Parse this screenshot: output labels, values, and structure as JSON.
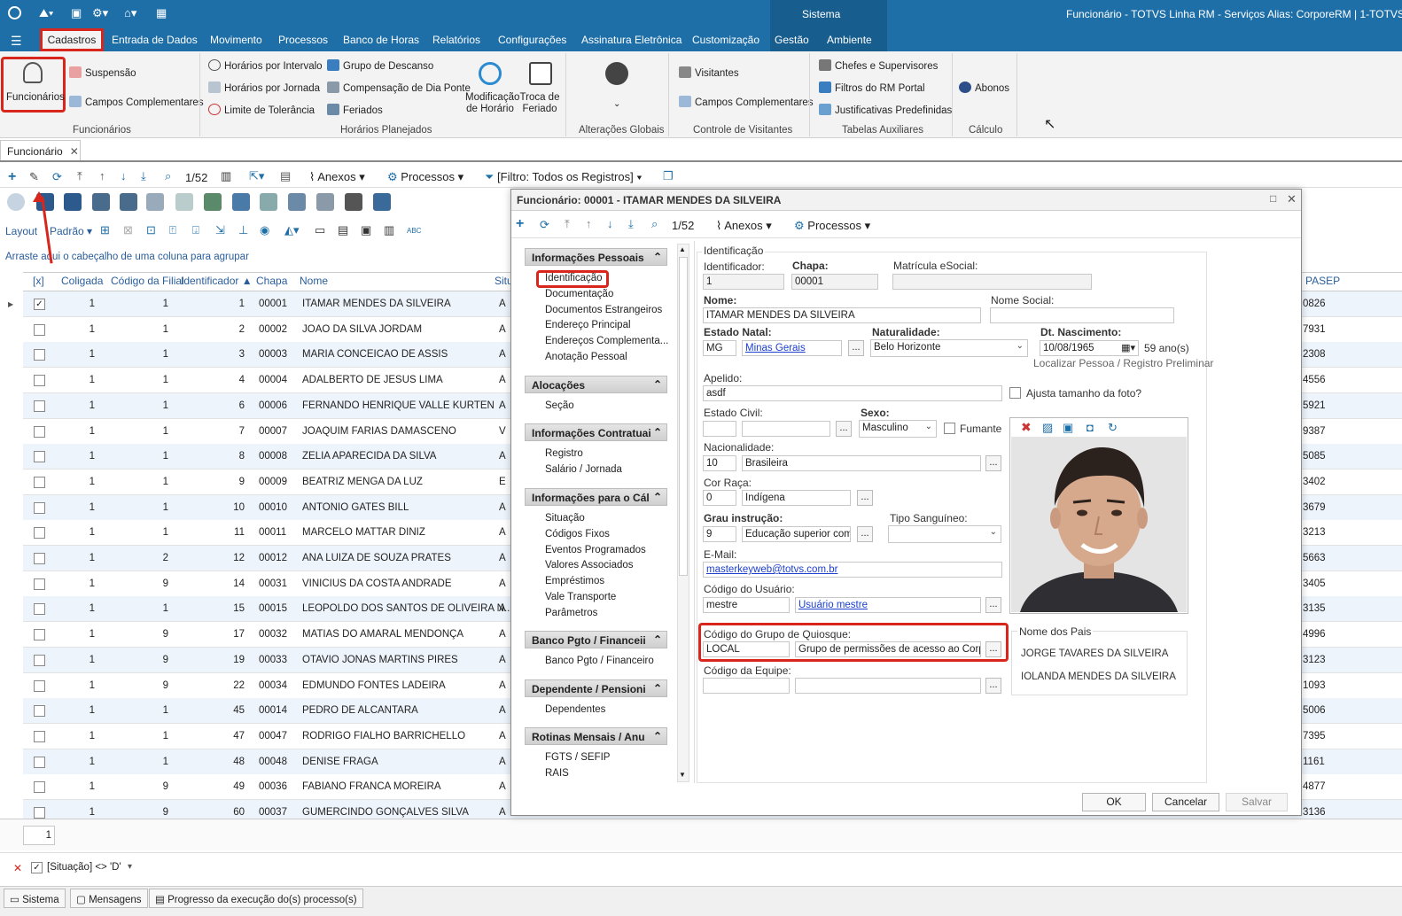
{
  "titlebar": {
    "right_text": "Funcionário - TOTVS Linha RM - Serviços  Alias: CorporeRM | 1-TOTVS SA",
    "sistema_label": "Sistema"
  },
  "menu": [
    "Cadastros",
    "Entrada de Dados",
    "Movimento",
    "Processos",
    "Banco de Horas",
    "Relatórios",
    "Configurações",
    "Assinatura Eletrônica",
    "Customização",
    "Gestão",
    "Ambiente"
  ],
  "ribbon": {
    "funcionarios": {
      "big": "Funcionários",
      "suspensao": "Suspensão",
      "campos": "Campos Complementares",
      "group": "Funcionários"
    },
    "horarios": {
      "intervalo": "Horários por Intervalo",
      "jornada": "Horários por Jornada",
      "limite": "Limite de Tolerância",
      "grupo": "Grupo de Descanso",
      "compensacao": "Compensação de Dia Ponte",
      "feriados": "Feriados",
      "modificacao": "Modificação de Horário",
      "troca": "Troca de Feriado",
      "group": "Horários Planejados"
    },
    "alteracoes": {
      "group": "Alterações Globais"
    },
    "visitantes": {
      "visitantes": "Visitantes",
      "campos": "Campos Complementares",
      "group": "Controle de Visitantes"
    },
    "tabelas": {
      "chefes": "Chefes e Supervisores",
      "filtros": "Filtros do RM Portal",
      "justificativas": "Justificativas Predefinidas",
      "group": "Tabelas Auxiliares"
    },
    "calculo": {
      "abonos": "Abonos",
      "group": "Cálculo"
    }
  },
  "doc_tab": "Funcionário",
  "toolbar": {
    "counter": "1/52",
    "anexos": "Anexos",
    "processos": "Processos",
    "filtro": "[Filtro: Todos os Registros]"
  },
  "layout_bar": {
    "layout": "Layout",
    "padrao": "Padrão"
  },
  "group_hint": "Arraste aqui o cabeçalho de uma coluna para agrupar",
  "grid": {
    "headers": [
      "[x]",
      "Coligada",
      "Código da Filial",
      "Identificador",
      "Chapa",
      "Nome",
      "Situ",
      "PASEP"
    ],
    "rows": [
      [
        "1",
        "1",
        "1",
        "00001",
        "ITAMAR MENDES DA SILVEIRA",
        "A",
        "0826"
      ],
      [
        "1",
        "1",
        "2",
        "00002",
        "JOAO DA SILVA JORDAM",
        "A",
        "7931"
      ],
      [
        "1",
        "1",
        "3",
        "00003",
        "MARIA CONCEICAO DE ASSIS",
        "A",
        "2308"
      ],
      [
        "1",
        "1",
        "4",
        "00004",
        "ADALBERTO DE JESUS LIMA",
        "A",
        "4556"
      ],
      [
        "1",
        "1",
        "6",
        "00006",
        "FERNANDO HENRIQUE VALLE KURTEN",
        "A",
        "5921"
      ],
      [
        "1",
        "1",
        "7",
        "00007",
        "JOAQUIM FARIAS DAMASCENO",
        "V",
        "9387"
      ],
      [
        "1",
        "1",
        "8",
        "00008",
        "ZELIA APARECIDA DA SILVA",
        "A",
        "5085"
      ],
      [
        "1",
        "1",
        "9",
        "00009",
        "BEATRIZ MENGA DA LUZ",
        "E",
        "3402"
      ],
      [
        "1",
        "1",
        "10",
        "00010",
        "ANTONIO GATES BILL",
        "A",
        "3679"
      ],
      [
        "1",
        "1",
        "11",
        "00011",
        "MARCELO MATTAR DINIZ",
        "A",
        "3213"
      ],
      [
        "1",
        "2",
        "12",
        "00012",
        "ANA LUIZA  DE SOUZA PRATES",
        "A",
        "5663"
      ],
      [
        "1",
        "9",
        "14",
        "00031",
        "VINICIUS DA COSTA ANDRADE",
        "A",
        "3405"
      ],
      [
        "1",
        "1",
        "15",
        "00015",
        "LEOPOLDO DOS SANTOS DE OLIVEIRA N...",
        "A",
        "3135"
      ],
      [
        "1",
        "9",
        "17",
        "00032",
        "MATIAS DO AMARAL MENDONÇA",
        "A",
        "4996"
      ],
      [
        "1",
        "9",
        "19",
        "00033",
        "OTAVIO JONAS MARTINS PIRES",
        "A",
        "3123"
      ],
      [
        "1",
        "9",
        "22",
        "00034",
        "EDMUNDO FONTES LADEIRA",
        "A",
        "1093"
      ],
      [
        "1",
        "1",
        "45",
        "00014",
        "PEDRO DE ALCANTARA",
        "A",
        "5006"
      ],
      [
        "1",
        "1",
        "47",
        "00047",
        "RODRIGO FIALHO BARRICHELLO",
        "A",
        "7395"
      ],
      [
        "1",
        "1",
        "48",
        "00048",
        "DENISE FRAGA",
        "A",
        "1161"
      ],
      [
        "1",
        "9",
        "49",
        "00036",
        "FABIANO FRANCA MOREIRA",
        "A",
        "4877"
      ],
      [
        "1",
        "9",
        "60",
        "00037",
        "GUMERCINDO GONÇALVES SILVA",
        "A",
        "3136"
      ]
    ],
    "footer_count": "1"
  },
  "filter_bar": {
    "text": "[Situação] <> 'D'"
  },
  "statusbar": {
    "sistema": "Sistema",
    "mensagens": "Mensagens",
    "progresso": "Progresso da execução do(s) processo(s)"
  },
  "modal": {
    "title": "Funcionário: 00001 - ITAMAR MENDES DA SILVEIRA",
    "counter": "1/52",
    "anexos": "Anexos",
    "processos": "Processos",
    "nav": [
      {
        "title": "Informações Pessoais",
        "items": [
          "Identificação",
          "Documentação",
          "Documentos Estrangeiros",
          "Endereço Principal",
          "Endereços Complementa...",
          "Anotação Pessoal"
        ]
      },
      {
        "title": "Alocações",
        "items": [
          "Seção"
        ]
      },
      {
        "title": "Informações Contratuai",
        "items": [
          "Registro",
          "Salário / Jornada"
        ]
      },
      {
        "title": "Informações para o Cál",
        "items": [
          "Situação",
          "Códigos Fixos",
          "Eventos Programados",
          "Valores Associados",
          "Empréstimos",
          "Vale Transporte",
          "Parâmetros"
        ]
      },
      {
        "title": "Banco Pgto / Financeii",
        "items": [
          "Banco Pgto / Financeiro"
        ]
      },
      {
        "title": "Dependente / Pensioni",
        "items": [
          "Dependentes"
        ]
      },
      {
        "title": "Rotinas Mensais / Anu",
        "items": [
          "FGTS / SEFIP",
          "RAIS"
        ]
      }
    ],
    "form": {
      "section": "Identificação",
      "identificador_label": "Identificador:",
      "identificador": "1",
      "chapa_label": "Chapa:",
      "chapa": "00001",
      "matricula_label": "Matrícula eSocial:",
      "matricula": "",
      "nome_label": "Nome:",
      "nome": "ITAMAR MENDES DA SILVEIRA",
      "nome_social_label": "Nome Social:",
      "nome_social": "",
      "estado_label": "Estado Natal:",
      "estado": "MG",
      "estado_nome": "Minas Gerais",
      "naturalidade_label": "Naturalidade:",
      "naturalidade": "Belo Horizonte",
      "dt_nasc_label": "Dt. Nascimento:",
      "dt_nasc": "10/08/1965",
      "idade": "59 ano(s)",
      "localizar": "Localizar Pessoa / Registro Preliminar",
      "apelido_label": "Apelido:",
      "apelido": "asdf",
      "ajusta": "Ajusta tamanho da foto?",
      "estado_civil_label": "Estado Civil:",
      "sexo_label": "Sexo:",
      "sexo": "Masculino",
      "fumante": "Fumante",
      "nacionalidade_label": "Nacionalidade:",
      "nac_cod": "10",
      "nac": "Brasileira",
      "cor_label": "Cor Raça:",
      "cor_cod": "0",
      "cor": "Indígena",
      "grau_label": "Grau instrução:",
      "grau_cod": "9",
      "grau": "Educação superior compl",
      "sangue_label": "Tipo Sanguíneo:",
      "email_label": "E-Mail:",
      "email": "masterkeyweb@totvs.com.br",
      "usuario_label": "Código do Usuário:",
      "usuario": "mestre",
      "usuario_nome": "Usuário mestre",
      "quiosque_label": "Código do Grupo de Quiosque:",
      "quiosque": "LOCAL",
      "quiosque_nome": "Grupo de permissões de acesso ao Corpore!",
      "equipe_label": "Código da Equipe:",
      "pais_label": "Nome dos Pais",
      "pai": "JORGE TAVARES DA SILVEIRA",
      "mae": "IOLANDA  MENDES DA SILVEIRA"
    },
    "buttons": {
      "ok": "OK",
      "cancelar": "Cancelar",
      "salvar": "Salvar"
    }
  }
}
